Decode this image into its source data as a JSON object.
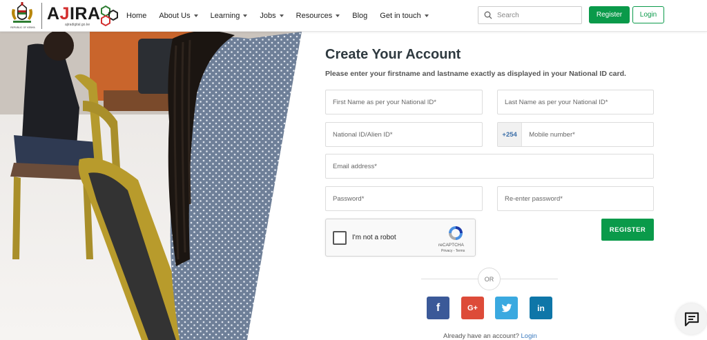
{
  "header": {
    "crest_text": "REPUBLIC OF KENYA",
    "logo_word_a": "A",
    "logo_word_j": "J",
    "logo_word_rest": "IRA",
    "logo_sub": "ajiradigital.go.ke",
    "nav": [
      {
        "label": "Home",
        "dropdown": false
      },
      {
        "label": "About Us",
        "dropdown": true
      },
      {
        "label": "Learning",
        "dropdown": true
      },
      {
        "label": "Jobs",
        "dropdown": true
      },
      {
        "label": "Resources",
        "dropdown": true
      },
      {
        "label": "Blog",
        "dropdown": false
      },
      {
        "label": "Get in touch",
        "dropdown": true
      }
    ],
    "search_placeholder": "Search",
    "register_label": "Register",
    "login_label": "Login"
  },
  "form": {
    "title": "Create Your Account",
    "subtitle": "Please enter your firstname and lastname exactly as displayed in your National ID card.",
    "first_name_placeholder": "First Name as per your National ID*",
    "last_name_placeholder": "Last Name as per your National ID*",
    "national_id_placeholder": "National ID/Alien ID*",
    "phone_prefix": "+254",
    "mobile_placeholder": "Mobile number*",
    "email_placeholder": "Email address*",
    "password_placeholder": "Password*",
    "reenter_password_placeholder": "Re-enter password*",
    "recaptcha_label": "I'm not a robot",
    "recaptcha_brand": "reCAPTCHA",
    "recaptcha_terms": "Privacy - Terms",
    "register_button": "REGISTER",
    "or_label": "OR",
    "have_account_text": "Already have an account?",
    "login_link": "Login"
  },
  "social": {
    "facebook": "f",
    "google": "G+",
    "twitter": "",
    "linkedin": "in"
  },
  "colors": {
    "brand_green": "#0a9a4a",
    "facebook": "#3b5998",
    "google": "#dd4b39",
    "twitter": "#3aa9e0",
    "linkedin": "#0e76a8"
  },
  "icons": [
    "kenya-crest-icon",
    "ajira-hexagon-logo-icon",
    "search-icon",
    "recaptcha-icon",
    "facebook-icon",
    "google-plus-icon",
    "twitter-icon",
    "linkedin-icon",
    "chat-icon"
  ]
}
